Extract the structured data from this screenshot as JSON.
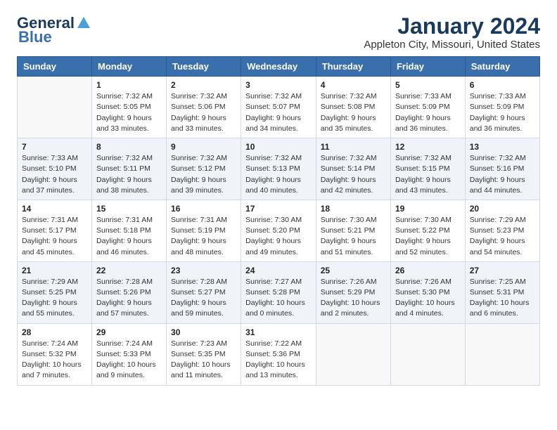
{
  "header": {
    "logo_line1": "General",
    "logo_line2": "Blue",
    "title": "January 2024",
    "location": "Appleton City, Missouri, United States"
  },
  "calendar": {
    "days_of_week": [
      "Sunday",
      "Monday",
      "Tuesday",
      "Wednesday",
      "Thursday",
      "Friday",
      "Saturday"
    ],
    "weeks": [
      [
        {
          "day": "",
          "sunrise": "",
          "sunset": "",
          "daylight": ""
        },
        {
          "day": "1",
          "sunrise": "Sunrise: 7:32 AM",
          "sunset": "Sunset: 5:05 PM",
          "daylight": "Daylight: 9 hours and 33 minutes."
        },
        {
          "day": "2",
          "sunrise": "Sunrise: 7:32 AM",
          "sunset": "Sunset: 5:06 PM",
          "daylight": "Daylight: 9 hours and 33 minutes."
        },
        {
          "day": "3",
          "sunrise": "Sunrise: 7:32 AM",
          "sunset": "Sunset: 5:07 PM",
          "daylight": "Daylight: 9 hours and 34 minutes."
        },
        {
          "day": "4",
          "sunrise": "Sunrise: 7:32 AM",
          "sunset": "Sunset: 5:08 PM",
          "daylight": "Daylight: 9 hours and 35 minutes."
        },
        {
          "day": "5",
          "sunrise": "Sunrise: 7:33 AM",
          "sunset": "Sunset: 5:09 PM",
          "daylight": "Daylight: 9 hours and 36 minutes."
        },
        {
          "day": "6",
          "sunrise": "Sunrise: 7:33 AM",
          "sunset": "Sunset: 5:09 PM",
          "daylight": "Daylight: 9 hours and 36 minutes."
        }
      ],
      [
        {
          "day": "7",
          "sunrise": "Sunrise: 7:33 AM",
          "sunset": "Sunset: 5:10 PM",
          "daylight": "Daylight: 9 hours and 37 minutes."
        },
        {
          "day": "8",
          "sunrise": "Sunrise: 7:32 AM",
          "sunset": "Sunset: 5:11 PM",
          "daylight": "Daylight: 9 hours and 38 minutes."
        },
        {
          "day": "9",
          "sunrise": "Sunrise: 7:32 AM",
          "sunset": "Sunset: 5:12 PM",
          "daylight": "Daylight: 9 hours and 39 minutes."
        },
        {
          "day": "10",
          "sunrise": "Sunrise: 7:32 AM",
          "sunset": "Sunset: 5:13 PM",
          "daylight": "Daylight: 9 hours and 40 minutes."
        },
        {
          "day": "11",
          "sunrise": "Sunrise: 7:32 AM",
          "sunset": "Sunset: 5:14 PM",
          "daylight": "Daylight: 9 hours and 42 minutes."
        },
        {
          "day": "12",
          "sunrise": "Sunrise: 7:32 AM",
          "sunset": "Sunset: 5:15 PM",
          "daylight": "Daylight: 9 hours and 43 minutes."
        },
        {
          "day": "13",
          "sunrise": "Sunrise: 7:32 AM",
          "sunset": "Sunset: 5:16 PM",
          "daylight": "Daylight: 9 hours and 44 minutes."
        }
      ],
      [
        {
          "day": "14",
          "sunrise": "Sunrise: 7:31 AM",
          "sunset": "Sunset: 5:17 PM",
          "daylight": "Daylight: 9 hours and 45 minutes."
        },
        {
          "day": "15",
          "sunrise": "Sunrise: 7:31 AM",
          "sunset": "Sunset: 5:18 PM",
          "daylight": "Daylight: 9 hours and 46 minutes."
        },
        {
          "day": "16",
          "sunrise": "Sunrise: 7:31 AM",
          "sunset": "Sunset: 5:19 PM",
          "daylight": "Daylight: 9 hours and 48 minutes."
        },
        {
          "day": "17",
          "sunrise": "Sunrise: 7:30 AM",
          "sunset": "Sunset: 5:20 PM",
          "daylight": "Daylight: 9 hours and 49 minutes."
        },
        {
          "day": "18",
          "sunrise": "Sunrise: 7:30 AM",
          "sunset": "Sunset: 5:21 PM",
          "daylight": "Daylight: 9 hours and 51 minutes."
        },
        {
          "day": "19",
          "sunrise": "Sunrise: 7:30 AM",
          "sunset": "Sunset: 5:22 PM",
          "daylight": "Daylight: 9 hours and 52 minutes."
        },
        {
          "day": "20",
          "sunrise": "Sunrise: 7:29 AM",
          "sunset": "Sunset: 5:23 PM",
          "daylight": "Daylight: 9 hours and 54 minutes."
        }
      ],
      [
        {
          "day": "21",
          "sunrise": "Sunrise: 7:29 AM",
          "sunset": "Sunset: 5:25 PM",
          "daylight": "Daylight: 9 hours and 55 minutes."
        },
        {
          "day": "22",
          "sunrise": "Sunrise: 7:28 AM",
          "sunset": "Sunset: 5:26 PM",
          "daylight": "Daylight: 9 hours and 57 minutes."
        },
        {
          "day": "23",
          "sunrise": "Sunrise: 7:28 AM",
          "sunset": "Sunset: 5:27 PM",
          "daylight": "Daylight: 9 hours and 59 minutes."
        },
        {
          "day": "24",
          "sunrise": "Sunrise: 7:27 AM",
          "sunset": "Sunset: 5:28 PM",
          "daylight": "Daylight: 10 hours and 0 minutes."
        },
        {
          "day": "25",
          "sunrise": "Sunrise: 7:26 AM",
          "sunset": "Sunset: 5:29 PM",
          "daylight": "Daylight: 10 hours and 2 minutes."
        },
        {
          "day": "26",
          "sunrise": "Sunrise: 7:26 AM",
          "sunset": "Sunset: 5:30 PM",
          "daylight": "Daylight: 10 hours and 4 minutes."
        },
        {
          "day": "27",
          "sunrise": "Sunrise: 7:25 AM",
          "sunset": "Sunset: 5:31 PM",
          "daylight": "Daylight: 10 hours and 6 minutes."
        }
      ],
      [
        {
          "day": "28",
          "sunrise": "Sunrise: 7:24 AM",
          "sunset": "Sunset: 5:32 PM",
          "daylight": "Daylight: 10 hours and 7 minutes."
        },
        {
          "day": "29",
          "sunrise": "Sunrise: 7:24 AM",
          "sunset": "Sunset: 5:33 PM",
          "daylight": "Daylight: 10 hours and 9 minutes."
        },
        {
          "day": "30",
          "sunrise": "Sunrise: 7:23 AM",
          "sunset": "Sunset: 5:35 PM",
          "daylight": "Daylight: 10 hours and 11 minutes."
        },
        {
          "day": "31",
          "sunrise": "Sunrise: 7:22 AM",
          "sunset": "Sunset: 5:36 PM",
          "daylight": "Daylight: 10 hours and 13 minutes."
        },
        {
          "day": "",
          "sunrise": "",
          "sunset": "",
          "daylight": ""
        },
        {
          "day": "",
          "sunrise": "",
          "sunset": "",
          "daylight": ""
        },
        {
          "day": "",
          "sunrise": "",
          "sunset": "",
          "daylight": ""
        }
      ]
    ]
  }
}
